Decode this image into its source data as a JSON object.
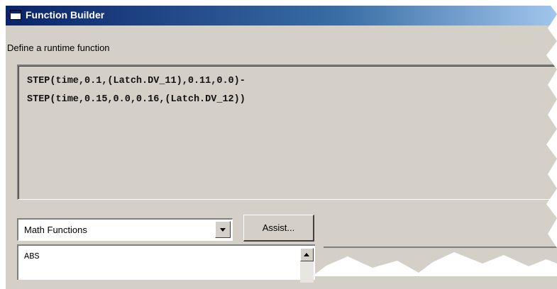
{
  "window": {
    "title": "Function Builder",
    "icon": "window-icon"
  },
  "prompt": "Define a runtime function",
  "editor": {
    "lines": [
      "STEP(time,0.1,(Latch.DV_11),0.11,0.0)-",
      "STEP(time,0.15,0.0,0.16,(Latch.DV_12))"
    ]
  },
  "category_select": {
    "value": "Math Functions",
    "arrow_icon": "chevron-down-icon"
  },
  "assist_button": {
    "label": "Assist..."
  },
  "function_list": {
    "items": [
      "ABS"
    ],
    "scroll_icon": "scroll-up-icon"
  },
  "colors": {
    "title_bar_start": "#0a246a",
    "title_bar_end": "#a6caf0",
    "face": "#d4d0c8"
  }
}
